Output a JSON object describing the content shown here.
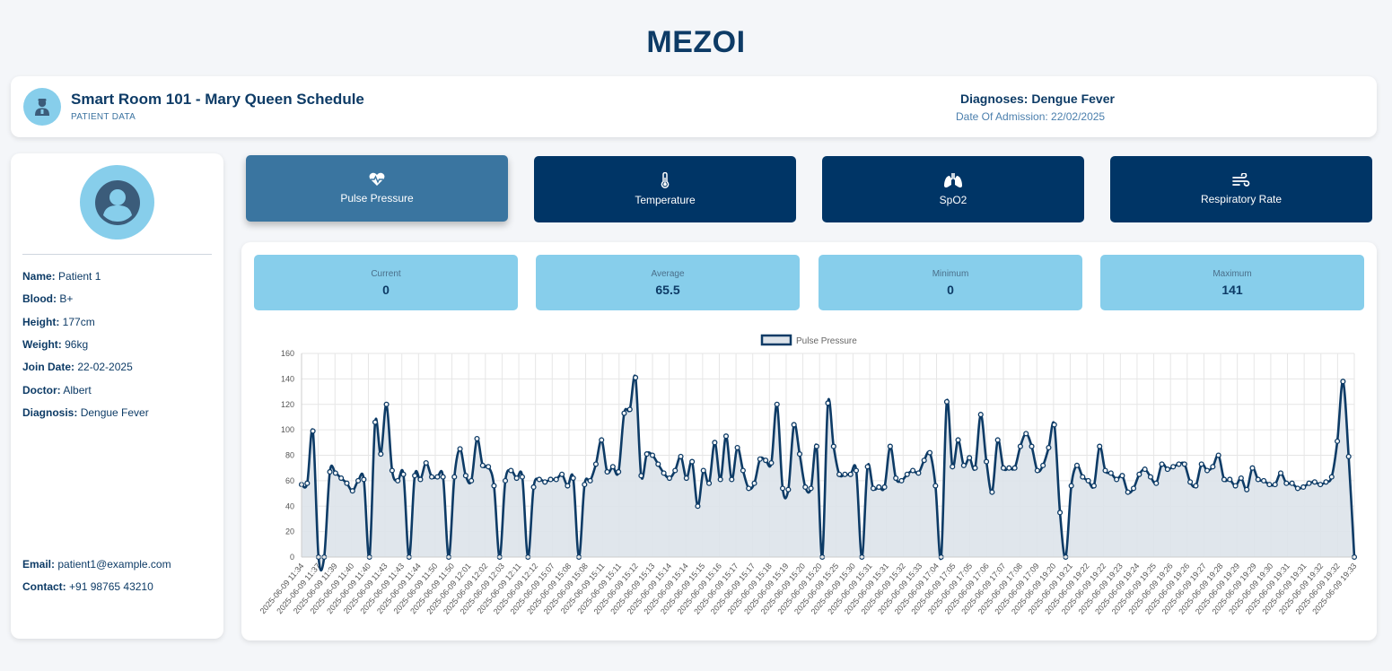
{
  "app": {
    "title": "MEZOI"
  },
  "header": {
    "title": "Smart Room 101 - Mary Queen Schedule",
    "subtitle": "PATIENT DATA",
    "avatar_icon": "patient-icon",
    "diagnosis": "Diagnoses: Dengue Fever",
    "admission": "Date Of Admission: 22/02/2025"
  },
  "patient": {
    "avatar_icon": "user-circle-icon",
    "fields": [
      {
        "label": "Name:",
        "value": "Patient 1"
      },
      {
        "label": "Blood:",
        "value": "B+"
      },
      {
        "label": "Height:",
        "value": "177cm"
      },
      {
        "label": "Weight:",
        "value": "96kg"
      },
      {
        "label": "Join Date:",
        "value": "22-02-2025"
      },
      {
        "label": "Doctor:",
        "value": "Albert"
      },
      {
        "label": "Diagnosis:",
        "value": "Dengue Fever"
      }
    ],
    "contact": [
      {
        "label": "Email:",
        "value": "patient1@example.com"
      },
      {
        "label": "Contact:",
        "value": "+91 98765 43210"
      }
    ]
  },
  "vitals": [
    {
      "label": "Pulse Pressure",
      "icon": "heart-pulse-icon",
      "active": true
    },
    {
      "label": "Temperature",
      "icon": "thermometer-icon",
      "active": false
    },
    {
      "label": "SpO2",
      "icon": "lungs-icon",
      "active": false
    },
    {
      "label": "Respiratory Rate",
      "icon": "wind-icon",
      "active": false
    }
  ],
  "stats": [
    {
      "label": "Current",
      "value": "0"
    },
    {
      "label": "Average",
      "value": "65.5"
    },
    {
      "label": "Minimum",
      "value": "0"
    },
    {
      "label": "Maximum",
      "value": "141"
    }
  ],
  "colors": {
    "navy": "#003566",
    "active": "#3a75a0",
    "sky": "#87ceeb",
    "line": "#0d3b66",
    "fill": "#dde3ea"
  },
  "chart_data": {
    "type": "line",
    "legend": [
      "Pulse Pressure"
    ],
    "legend_position": "top-center",
    "ylim": [
      0,
      160
    ],
    "yticks": [
      0,
      20,
      40,
      60,
      80,
      100,
      120,
      140,
      160
    ],
    "grid": true,
    "series": [
      {
        "name": "Pulse Pressure",
        "values": [
          57,
          58,
          99,
          0,
          0,
          67,
          66,
          62,
          58,
          52,
          60,
          61,
          0,
          106,
          81,
          120,
          68,
          60,
          65,
          0,
          64,
          61,
          74,
          63,
          63,
          63,
          0,
          63,
          85,
          64,
          60,
          93,
          72,
          71,
          56,
          0,
          60,
          68,
          62,
          63,
          0,
          55,
          61,
          59,
          61,
          61,
          65,
          56,
          62,
          0,
          57,
          60,
          73,
          92,
          67,
          71,
          67,
          113,
          116,
          141,
          64,
          81,
          80,
          73,
          66,
          62,
          68,
          79,
          62,
          75,
          40,
          68,
          58,
          90,
          61,
          95,
          61,
          86,
          68,
          54,
          58,
          77,
          76,
          74,
          120,
          54,
          53,
          104,
          81,
          55,
          54,
          87,
          0,
          121,
          87,
          65,
          65,
          65,
          68,
          0,
          71,
          54,
          55,
          55,
          87,
          62,
          60,
          65,
          68,
          66,
          76,
          82,
          56,
          0,
          122,
          71,
          92,
          72,
          78,
          70,
          112,
          75,
          51,
          92,
          70,
          70,
          70,
          87,
          97,
          87,
          68,
          72,
          86,
          104,
          35,
          0,
          56,
          72,
          63,
          60,
          56,
          87,
          68,
          66,
          61,
          64,
          51,
          54,
          65,
          69,
          63,
          58,
          73,
          69,
          71,
          73,
          73,
          59,
          56,
          73,
          68,
          71,
          80,
          61,
          61,
          56,
          62,
          53,
          70,
          61,
          60,
          57,
          57,
          66,
          58,
          58,
          54,
          55,
          58,
          59,
          57,
          59,
          63,
          91,
          138,
          79,
          0
        ],
        "x_tick_labels": [
          "2025-06-09 11:34",
          "2025-06-09 11:37",
          "2025-06-09 11:39",
          "2025-06-09 11:40",
          "2025-06-09 11:40",
          "2025-06-09 11:43",
          "2025-06-09 11:43",
          "2025-06-09 11:44",
          "2025-06-09 11:50",
          "2025-06-09 11:50",
          "2025-06-09 12:01",
          "2025-06-09 12:02",
          "2025-06-09 12:03",
          "2025-06-09 12:11",
          "2025-06-09 12:12",
          "2025-06-09 15:07",
          "2025-06-09 15:08",
          "2025-06-09 15:08",
          "2025-06-09 15:11",
          "2025-06-09 15:11",
          "2025-06-09 15:12",
          "2025-06-09 15:13",
          "2025-06-09 15:14",
          "2025-06-09 15:14",
          "2025-06-09 15:15",
          "2025-06-09 15:16",
          "2025-06-09 15:17",
          "2025-06-09 15:17",
          "2025-06-09 15:18",
          "2025-06-09 15:19",
          "2025-06-09 15:20",
          "2025-06-09 15:20",
          "2025-06-09 15:25",
          "2025-06-09 15:30",
          "2025-06-09 15:31",
          "2025-06-09 15:31",
          "2025-06-09 15:32",
          "2025-06-09 15:33",
          "2025-06-09 17:04",
          "2025-06-09 17:05",
          "2025-06-09 17:05",
          "2025-06-09 17:06",
          "2025-06-09 17:07",
          "2025-06-09 17:08",
          "2025-06-09 17:09",
          "2025-06-09 19:20",
          "2025-06-09 19:21",
          "2025-06-09 19:22",
          "2025-06-09 19:22",
          "2025-06-09 19:23",
          "2025-06-09 19:24",
          "2025-06-09 19:25",
          "2025-06-09 19:26",
          "2025-06-09 19:26",
          "2025-06-09 19:27",
          "2025-06-09 19:28",
          "2025-06-09 19:29",
          "2025-06-09 19:29",
          "2025-06-09 19:30",
          "2025-06-09 19:31",
          "2025-06-09 19:31",
          "2025-06-09 19:32",
          "2025-06-09 19:32",
          "2025-06-09 19:33"
        ]
      }
    ]
  }
}
